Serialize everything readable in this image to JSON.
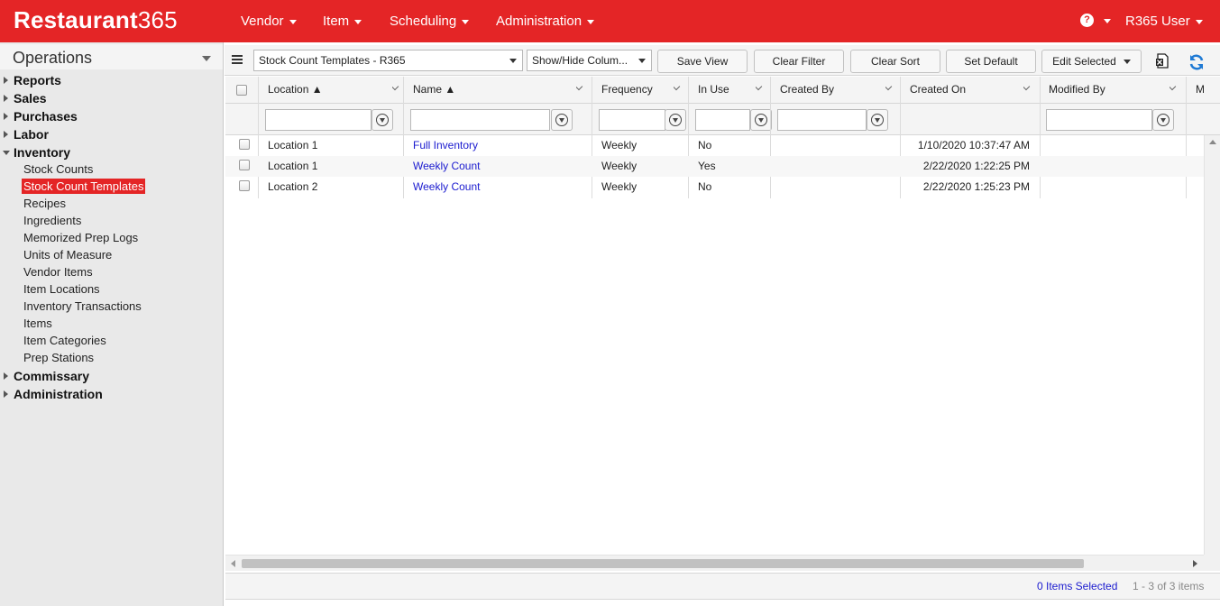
{
  "app": {
    "brand_word": "Restaurant",
    "brand_num": "365",
    "accent_color": "#e42526"
  },
  "topnav": {
    "items": [
      {
        "label": "Vendor"
      },
      {
        "label": "Item"
      },
      {
        "label": "Scheduling"
      },
      {
        "label": "Administration"
      }
    ],
    "help_icon": "?",
    "user": "R365 User"
  },
  "sidebar": {
    "title": "Operations",
    "groups": [
      {
        "label": "Reports"
      },
      {
        "label": "Sales"
      },
      {
        "label": "Purchases"
      },
      {
        "label": "Labor"
      },
      {
        "label": "Inventory"
      },
      {
        "label": "Commissary"
      },
      {
        "label": "Administration"
      }
    ],
    "inventory_items": [
      {
        "label": "Stock Counts"
      },
      {
        "label": "Stock Count Templates"
      },
      {
        "label": "Recipes"
      },
      {
        "label": "Ingredients"
      },
      {
        "label": "Memorized Prep Logs"
      },
      {
        "label": "Units of Measure"
      },
      {
        "label": "Vendor Items"
      },
      {
        "label": "Item Locations"
      },
      {
        "label": "Inventory Transactions"
      },
      {
        "label": "Items"
      },
      {
        "label": "Item Categories"
      },
      {
        "label": "Prep Stations"
      }
    ]
  },
  "toolbar": {
    "view_select": "Stock Count Templates - R365",
    "show_hide": "Show/Hide Colum...",
    "save_view": "Save View",
    "clear_filter": "Clear Filter",
    "clear_sort": "Clear Sort",
    "set_default": "Set Default",
    "edit_selected": "Edit Selected"
  },
  "grid": {
    "columns": [
      {
        "label": "Location ▲"
      },
      {
        "label": "Name ▲"
      },
      {
        "label": "Frequency"
      },
      {
        "label": "In Use"
      },
      {
        "label": "Created By"
      },
      {
        "label": "Created On"
      },
      {
        "label": "Modified By"
      },
      {
        "label": "M"
      }
    ],
    "rows": [
      {
        "location": "Location 1",
        "name": "Full Inventory",
        "frequency": "Weekly",
        "in_use": "No",
        "created_by": "",
        "created_on": "1/10/2020 10:37:47 AM",
        "modified_by": ""
      },
      {
        "location": "Location 1",
        "name": "Weekly Count",
        "frequency": "Weekly",
        "in_use": "Yes",
        "created_by": "",
        "created_on": "2/22/2020 1:22:25 PM",
        "modified_by": ""
      },
      {
        "location": "Location 2",
        "name": "Weekly Count",
        "frequency": "Weekly",
        "in_use": "No",
        "created_by": "",
        "created_on": "2/22/2020 1:25:23 PM",
        "modified_by": ""
      }
    ]
  },
  "footer": {
    "selected": "0 Items Selected",
    "count": "1 - 3 of 3 items"
  }
}
